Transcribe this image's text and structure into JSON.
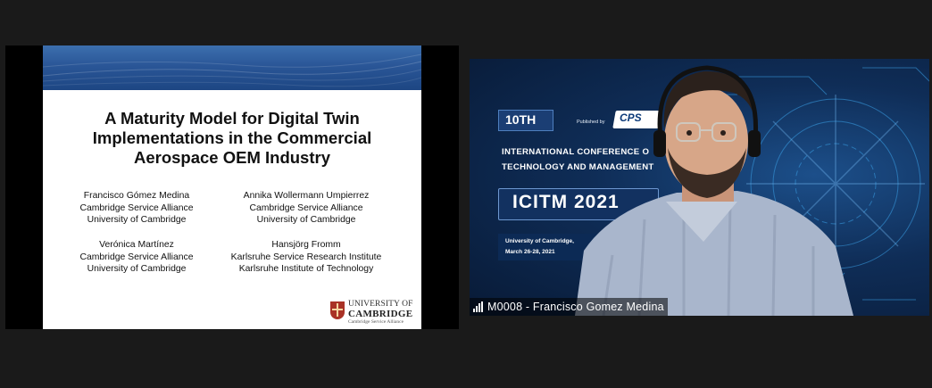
{
  "slide": {
    "title_line1": "A Maturity Model for Digital Twin",
    "title_line2": "Implementations in the Commercial",
    "title_line3": "Aerospace OEM Industry",
    "authors": [
      {
        "name": "Francisco Gómez Medina",
        "org": "Cambridge Service Alliance",
        "inst": "University of Cambridge"
      },
      {
        "name": "Annika Wollermann Umpierrez",
        "org": "Cambridge Service Alliance",
        "inst": "University of Cambridge"
      },
      {
        "name": "Verónica Martínez",
        "org": "Cambridge Service Alliance",
        "inst": "University of Cambridge"
      },
      {
        "name": "Hansjörg Fromm",
        "org": "Karlsruhe Service Research Institute",
        "inst": "Karlsruhe Institute of Technology"
      }
    ],
    "logo": {
      "line1": "UNIVERSITY OF",
      "line2": "CAMBRIDGE",
      "line3": "Cambridge Service Alliance",
      "icon": "crest-icon"
    }
  },
  "camera": {
    "backdrop": {
      "edition": "10TH",
      "published_by": "Published by",
      "publisher": "CPS",
      "conference_line1": "INTERNATIONAL CONFERENCE O",
      "conference_line2": "TECHNOLOGY AND MANAGEMENT",
      "acronym": "ICITM 2021",
      "venue_line1": "University of Cambridge, ",
      "venue_line2": "March 26-28, 2021"
    },
    "participant": {
      "name_label": "M0008 - Francisco Gomez Medina",
      "signal_icon": "signal-strength-icon"
    }
  },
  "colors": {
    "background": "#1a1a1a",
    "slide_band": "#2a5697",
    "backdrop": "#0f2d57",
    "crest": "#a93226"
  }
}
